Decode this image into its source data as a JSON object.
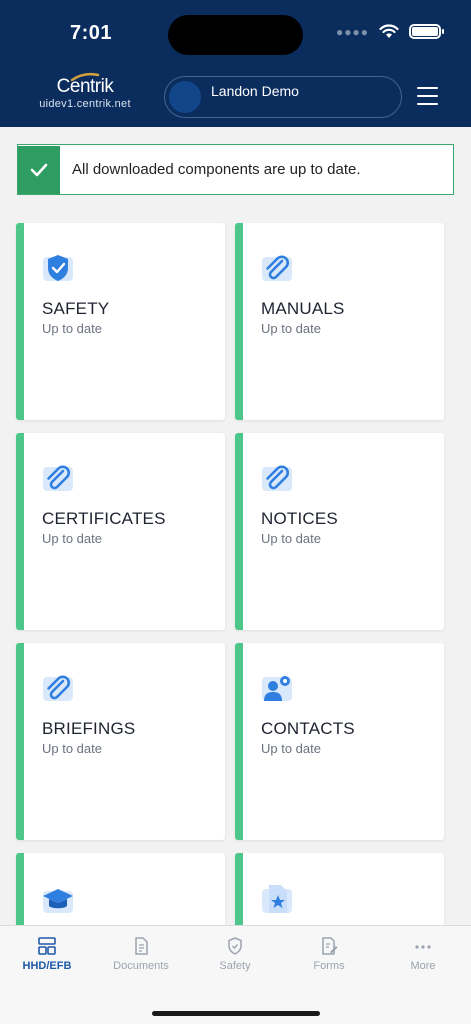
{
  "status_bar": {
    "time": "7:01"
  },
  "header": {
    "logo_text": "Centrik",
    "logo_subtitle": "uidev1.centrik.net",
    "user_name": "Landon Demo"
  },
  "banner": {
    "message": "All downloaded components are up to date."
  },
  "tiles": [
    {
      "title": "SAFETY",
      "status": "Up to date",
      "icon": "shield-icon"
    },
    {
      "title": "MANUALS",
      "status": "Up to date",
      "icon": "paperclip-icon"
    },
    {
      "title": "CERTIFICATES",
      "status": "Up to date",
      "icon": "paperclip-icon"
    },
    {
      "title": "NOTICES",
      "status": "Up to date",
      "icon": "paperclip-icon"
    },
    {
      "title": "BRIEFINGS",
      "status": "Up to date",
      "icon": "paperclip-icon"
    },
    {
      "title": "CONTACTS",
      "status": "Up to date",
      "icon": "contact-settings-icon"
    },
    {
      "title": "",
      "status": "",
      "icon": "graduation-cap-icon"
    },
    {
      "title": "",
      "status": "",
      "icon": "star-document-icon"
    }
  ],
  "tabbar": [
    {
      "label": "HHD/EFB",
      "icon": "dashboard-icon",
      "active": true
    },
    {
      "label": "Documents",
      "icon": "document-icon",
      "active": false
    },
    {
      "label": "Safety",
      "icon": "shield-outline-icon",
      "active": false
    },
    {
      "label": "Forms",
      "icon": "form-edit-icon",
      "active": false
    },
    {
      "label": "More",
      "icon": "more-dots-icon",
      "active": false
    }
  ],
  "colors": {
    "header_bg": "#0b2d5e",
    "accent_green": "#4cc789",
    "banner_green": "#2e9d62",
    "active_tab": "#1e5aa8"
  }
}
